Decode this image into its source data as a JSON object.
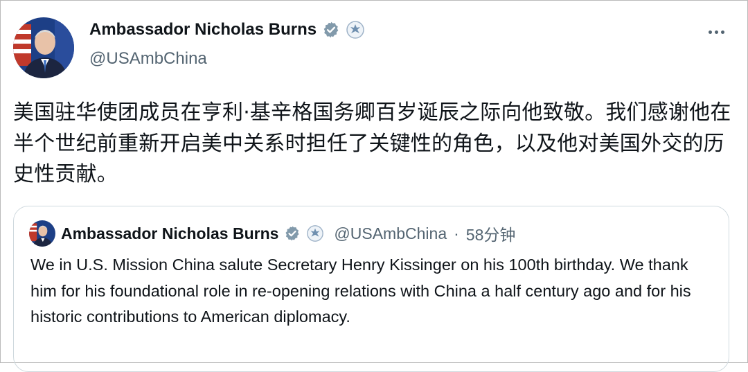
{
  "author": {
    "display_name": "Ambassador Nicholas Burns",
    "handle": "@USAmbChina"
  },
  "icons": {
    "verified": "verified-badge-icon",
    "seal": "government-seal-icon",
    "more": "more-options-icon"
  },
  "colors": {
    "text_primary": "#0f1419",
    "text_secondary": "#536471",
    "verified_badge": "#829aab",
    "border": "#cfd9de"
  },
  "tweet": {
    "text": "美国驻华使团成员在亨利·基辛格国务卿百岁诞辰之际向他致敬。我们感谢他在半个世纪前重新开启美中关系时担任了关键性的角色，以及他对美国外交的历史性贡献。"
  },
  "quoted_tweet": {
    "display_name": "Ambassador Nicholas Burns",
    "handle": "@USAmbChina",
    "separator": "·",
    "time": "58分钟",
    "text": "We in U.S. Mission China salute Secretary Henry Kissinger on his 100th birthday. We thank him for his foundational role in re-opening relations with China a half century ago and for his historic contributions to American diplomacy."
  }
}
